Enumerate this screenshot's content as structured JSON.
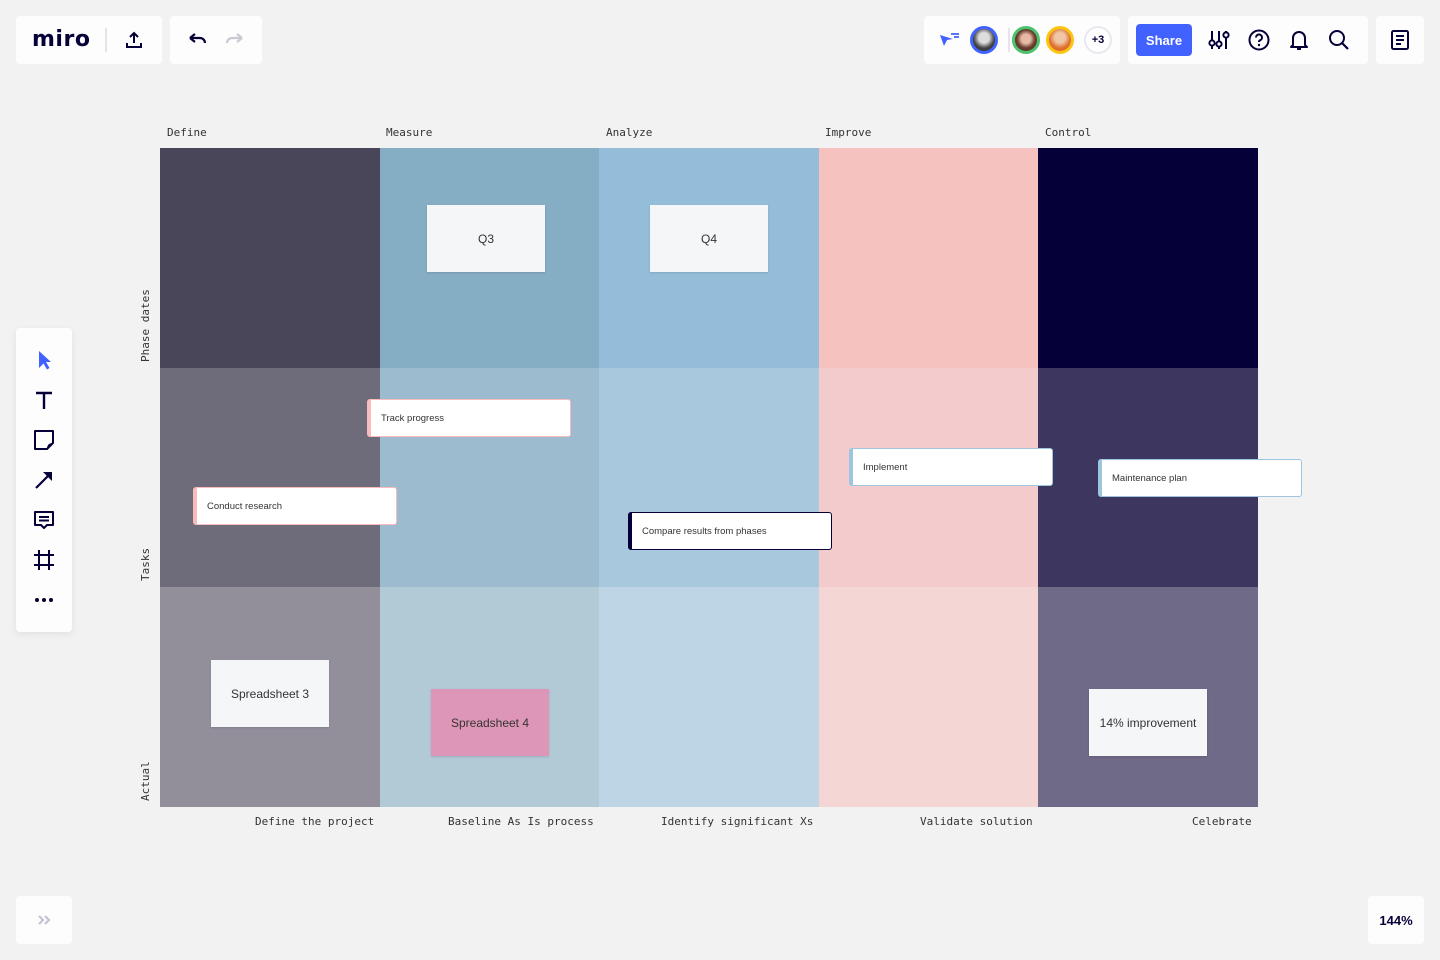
{
  "app": {
    "logo": "miro",
    "zoom_level": "144%",
    "share_label": "Share",
    "extra_collaborators": "+3",
    "icons": {
      "export": "upload-icon",
      "undo": "undo-icon",
      "redo": "redo-icon",
      "cursor_share": "cursor-share-icon",
      "settings": "sliders-icon",
      "help": "help-icon",
      "notifications": "bell-icon",
      "search": "search-icon",
      "notes": "notes-icon",
      "expand": "double-chevron-icon"
    },
    "collaborators": [
      {
        "name": "collaborator-1",
        "ring": "#4262ff"
      },
      {
        "name": "collaborator-2",
        "ring": "#4cc26c"
      },
      {
        "name": "collaborator-3",
        "ring": "#fac710"
      }
    ],
    "accent": "#4262ff"
  },
  "toolbar": {
    "tools": [
      {
        "name": "select-tool",
        "icon": "cursor-icon",
        "active": true
      },
      {
        "name": "text-tool",
        "icon": "text-icon"
      },
      {
        "name": "sticky-note-tool",
        "icon": "sticky-note-icon"
      },
      {
        "name": "connection-line-tool",
        "icon": "arrow-icon"
      },
      {
        "name": "comment-tool",
        "icon": "comment-icon"
      },
      {
        "name": "frame-tool",
        "icon": "frame-icon"
      },
      {
        "name": "more-tools",
        "icon": "more-icon"
      }
    ]
  },
  "board": {
    "phases": [
      "Define",
      "Measure",
      "Analyze",
      "Improve",
      "Control"
    ],
    "rows": [
      "Phase dates",
      "Tasks",
      "Actual"
    ],
    "footers": [
      "Define the project",
      "Baseline As Is process",
      "Identify significant Xs",
      "Validate solution",
      "Celebrate"
    ],
    "cell_colors": [
      [
        "#484658",
        "#85adc3",
        "#93bdd9",
        "#f5c2c0",
        "#050038"
      ],
      [
        "#6e6b7b",
        "#9dbbce",
        "#a8c8de",
        "#f3cbcc",
        "#3d365f"
      ],
      [
        "#928f9b",
        "#b2c9d6",
        "#bdd5e4",
        "#f4d6d5",
        "#6f6a87"
      ]
    ],
    "stickies": [
      {
        "text": "Q3",
        "color": "#f5f6f8"
      },
      {
        "text": "Q4",
        "color": "#f5f6f8"
      },
      {
        "text": "Spreadsheet 3",
        "color": "#f5f6f8"
      },
      {
        "text": "Spreadsheet 4",
        "color": "#de96b8"
      },
      {
        "text": "14% improvement",
        "color": "#f5f6f8"
      }
    ],
    "cards": [
      {
        "text": "Track progress",
        "accent": "#f8bcbc"
      },
      {
        "text": "Conduct research",
        "accent": "#f8bcbc"
      },
      {
        "text": "Implement",
        "accent": "#9dc4e0"
      },
      {
        "text": "Compare results from phases",
        "accent": "#050038"
      },
      {
        "text": "Maintenance plan",
        "accent": "#9dc4e0"
      }
    ]
  }
}
